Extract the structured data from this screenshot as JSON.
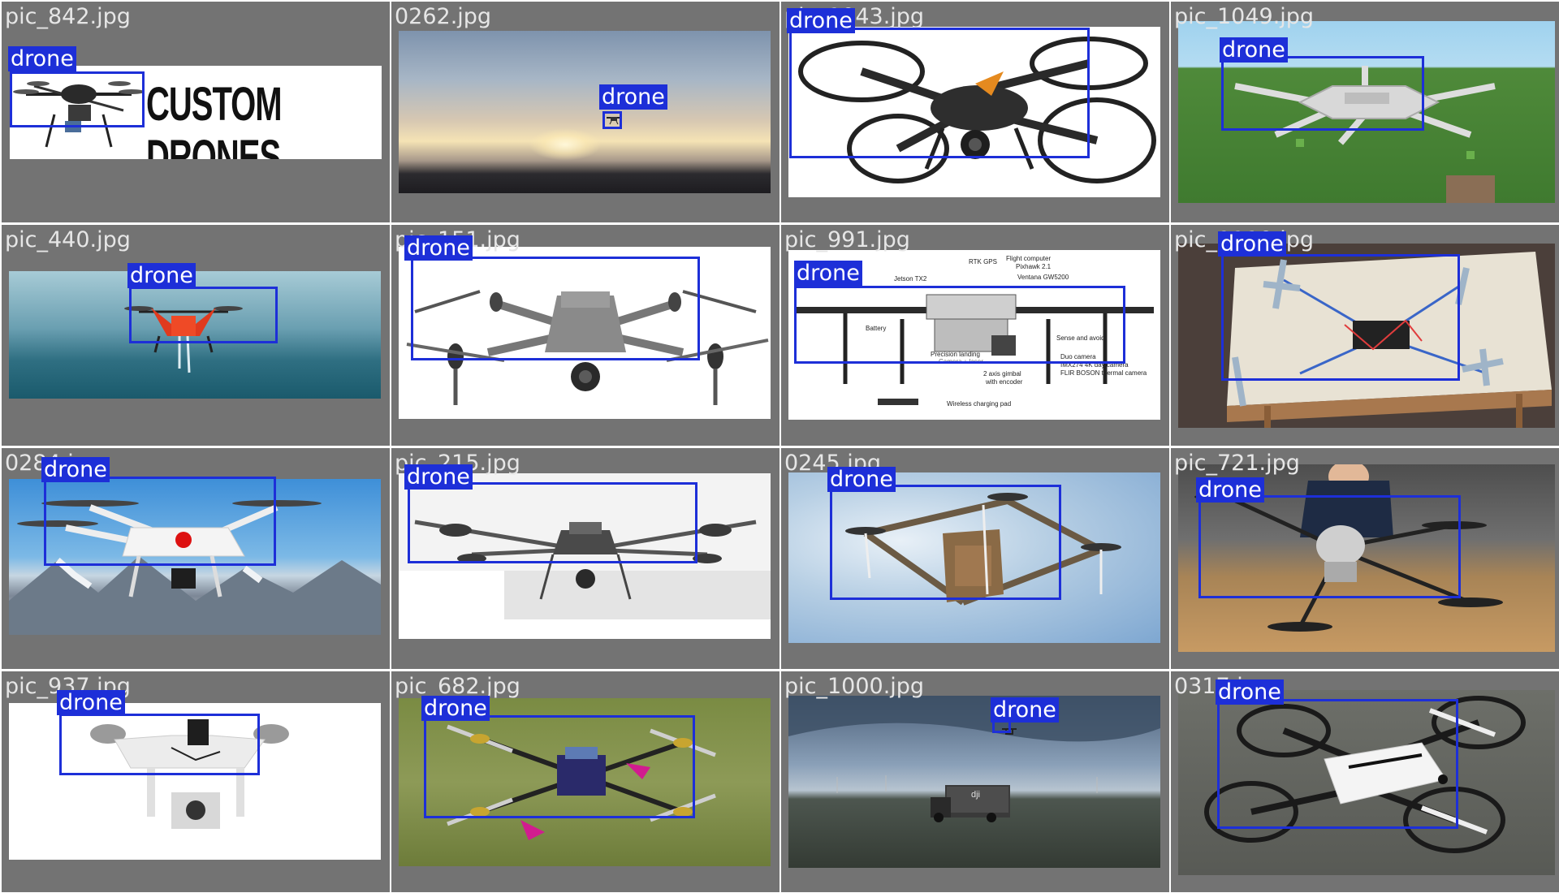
{
  "label": "drone",
  "colors": {
    "box": "#1d2fd8",
    "tile_bg": "#737373",
    "filename": "#e6e6e6"
  },
  "tiles": [
    {
      "filename": "pic_842.jpg",
      "logo_text": "CUSTOM DRONES"
    },
    {
      "filename": "0262.jpg"
    },
    {
      "filename": "pic_1043.jpg"
    },
    {
      "filename": "pic_1049.jpg"
    },
    {
      "filename": "pic_440.jpg"
    },
    {
      "filename": "pic_151.jpg"
    },
    {
      "filename": "pic_991.jpg",
      "annotations": [
        "RTK GPS",
        "Flight computer",
        "Pixhawk 2.1",
        "Jetson TX2",
        "Ventana GW5200",
        "Battery",
        "Sense and avoid",
        "Precision landing",
        "Camera + laser",
        "Duo camera",
        "IMX274 4K day camera",
        "FLIR BOSON thermal camera",
        "2 axis gimbal",
        "with encoder",
        "Wireless charging pad"
      ]
    },
    {
      "filename": "pic_1110.jpg"
    },
    {
      "filename": "0284.jpg"
    },
    {
      "filename": "pic_215.jpg"
    },
    {
      "filename": "0245.jpg"
    },
    {
      "filename": "pic_721.jpg"
    },
    {
      "filename": "pic_937.jpg"
    },
    {
      "filename": "pic_682.jpg"
    },
    {
      "filename": "pic_1000.jpg",
      "truck_text": "dji"
    },
    {
      "filename": "0317.jpg"
    }
  ]
}
